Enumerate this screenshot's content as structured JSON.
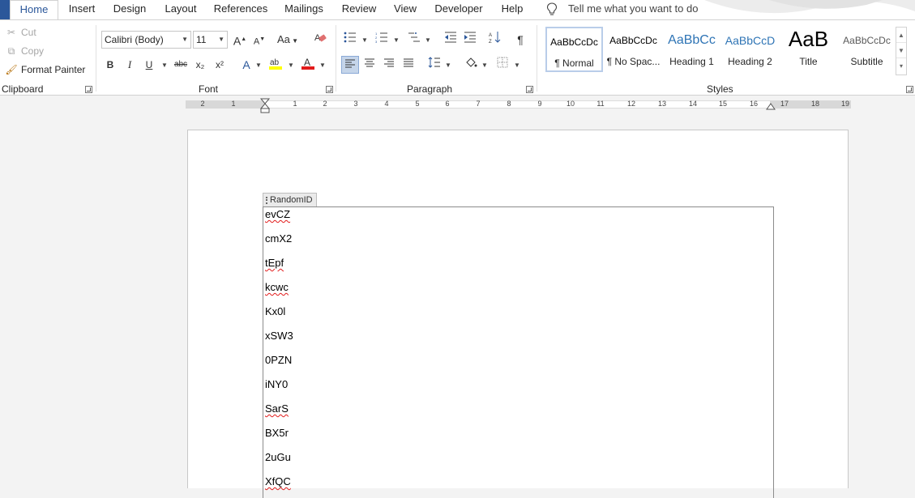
{
  "tabs": {
    "home": "Home",
    "insert": "Insert",
    "design": "Design",
    "layout": "Layout",
    "references": "References",
    "mailings": "Mailings",
    "review": "Review",
    "view": "View",
    "developer": "Developer",
    "help": "Help",
    "tell_me": "Tell me what you want to do"
  },
  "clipboard": {
    "cut": "Cut",
    "copy": "Copy",
    "format_painter": "Format Painter",
    "label": "Clipboard"
  },
  "font": {
    "name": "Calibri (Body)",
    "size": "11",
    "case_label": "Aa",
    "label": "Font",
    "bold": "B",
    "italic": "I",
    "underline": "U",
    "strike": "abc",
    "subscript": "x₂",
    "superscript": "x²",
    "grow": "A",
    "shrink": "A"
  },
  "paragraph": {
    "label": "Paragraph",
    "pilcrow": "¶"
  },
  "styles": {
    "label": "Styles",
    "items": [
      {
        "sample": "AaBbCcDc",
        "name": "¶ Normal"
      },
      {
        "sample": "AaBbCcDc",
        "name": "¶ No Spac..."
      },
      {
        "sample": "AaBbCc",
        "name": "Heading 1"
      },
      {
        "sample": "AaBbCcD",
        "name": "Heading 2"
      },
      {
        "sample": "AaB",
        "name": "Title"
      },
      {
        "sample": "AaBbCcDc",
        "name": "Subtitle"
      }
    ]
  },
  "ruler": {
    "left_numbers": [
      "2",
      "1"
    ],
    "right_numbers": [
      "1",
      "2",
      "3",
      "4",
      "5",
      "6",
      "7",
      "8",
      "9",
      "10",
      "11",
      "12",
      "13",
      "14",
      "15",
      "16",
      "17",
      "18",
      "19"
    ]
  },
  "document": {
    "content_control_tag": "RandomID",
    "paragraphs": [
      "evCZ",
      "cmX2",
      "tEpf",
      "kcwc",
      "Kx0l",
      "xSW3",
      "0PZN",
      "iNY0",
      "SarS",
      "BX5r",
      "2uGu",
      "XfQC"
    ],
    "misspelled": [
      true,
      false,
      true,
      true,
      false,
      false,
      false,
      false,
      true,
      false,
      false,
      true
    ]
  },
  "colors": {
    "accent": "#2b579a",
    "highlight": "#ffff00",
    "font_color": "#e21b1b"
  }
}
